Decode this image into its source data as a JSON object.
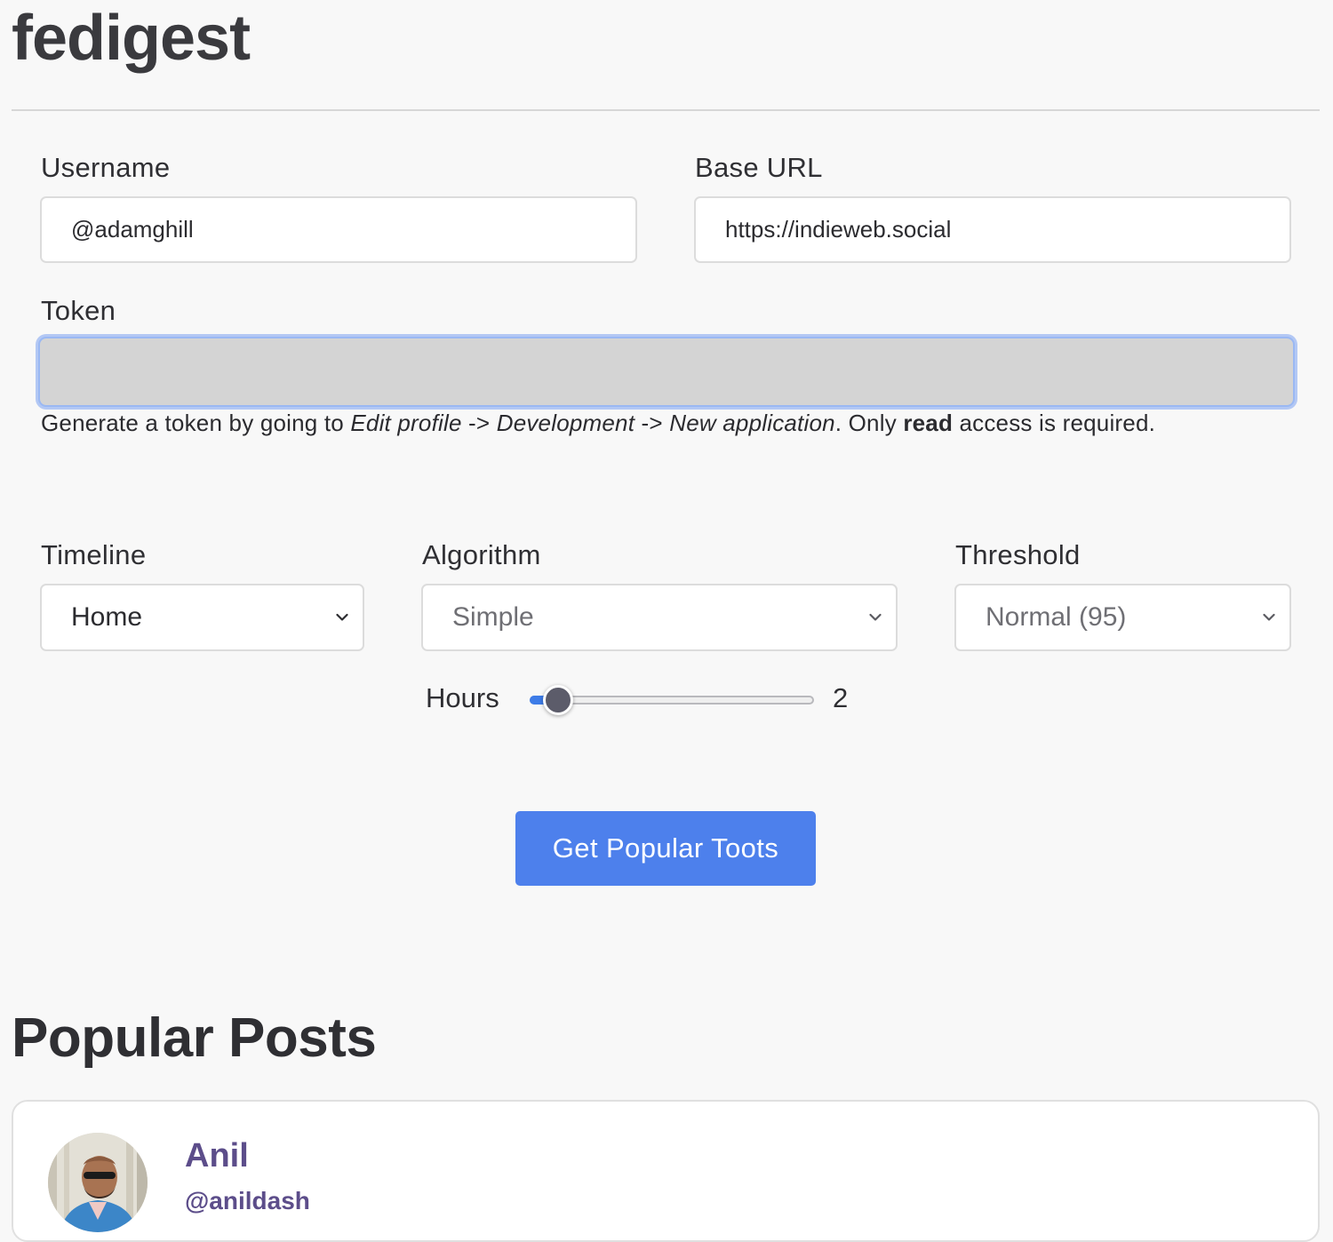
{
  "app": {
    "title": "fedigest"
  },
  "form": {
    "username": {
      "label": "Username",
      "value": "@adamghill"
    },
    "base_url": {
      "label": "Base URL",
      "value": "https://indieweb.social"
    },
    "token": {
      "label": "Token",
      "value": "",
      "help": {
        "prefix": "Generate a token by going to ",
        "step1": "Edit profile",
        "arrow1": " -> ",
        "step2": "Development",
        "arrow2": " -> ",
        "step3": "New application",
        "middle": ". Only ",
        "access": "read",
        "suffix": " access is required."
      }
    },
    "timeline": {
      "label": "Timeline",
      "selected": "Home"
    },
    "algorithm": {
      "label": "Algorithm",
      "selected": "Simple"
    },
    "threshold": {
      "label": "Threshold",
      "selected": "Normal (95)"
    },
    "hours": {
      "label": "Hours",
      "value": "2",
      "slider_position_fraction": 0.1
    },
    "submit_label": "Get Popular Toots"
  },
  "posts": {
    "title": "Popular Posts",
    "items": [
      {
        "display_name": "Anil",
        "handle": "@anildash",
        "avatar_icon": "user-avatar-photo"
      }
    ]
  },
  "colors": {
    "accent": "#4d80ec",
    "author": "#5c4d8a",
    "focus_ring": "#9ab8f3",
    "background": "#f8f8f8"
  }
}
